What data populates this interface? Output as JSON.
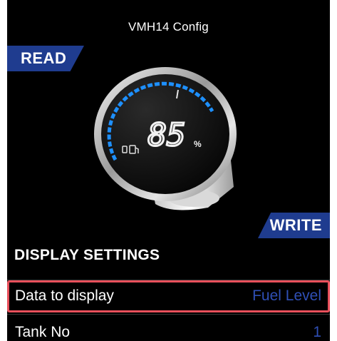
{
  "header": {
    "title": "VMH14 Config"
  },
  "ribbons": {
    "read_label": "READ",
    "write_label": "WRITE"
  },
  "gauge": {
    "value": "85",
    "unit": "%",
    "level_percent": 85
  },
  "settings": {
    "section_title": "DISPLAY SETTINGS",
    "rows": [
      {
        "label": "Data to display",
        "value": "Fuel Level"
      },
      {
        "label": "Tank No",
        "value": "1"
      }
    ]
  },
  "colors": {
    "accent": "#1f3c8f",
    "value_text": "#2f4fb5",
    "highlight_border": "#e8505b",
    "gauge_arc": "#1e90ff"
  }
}
